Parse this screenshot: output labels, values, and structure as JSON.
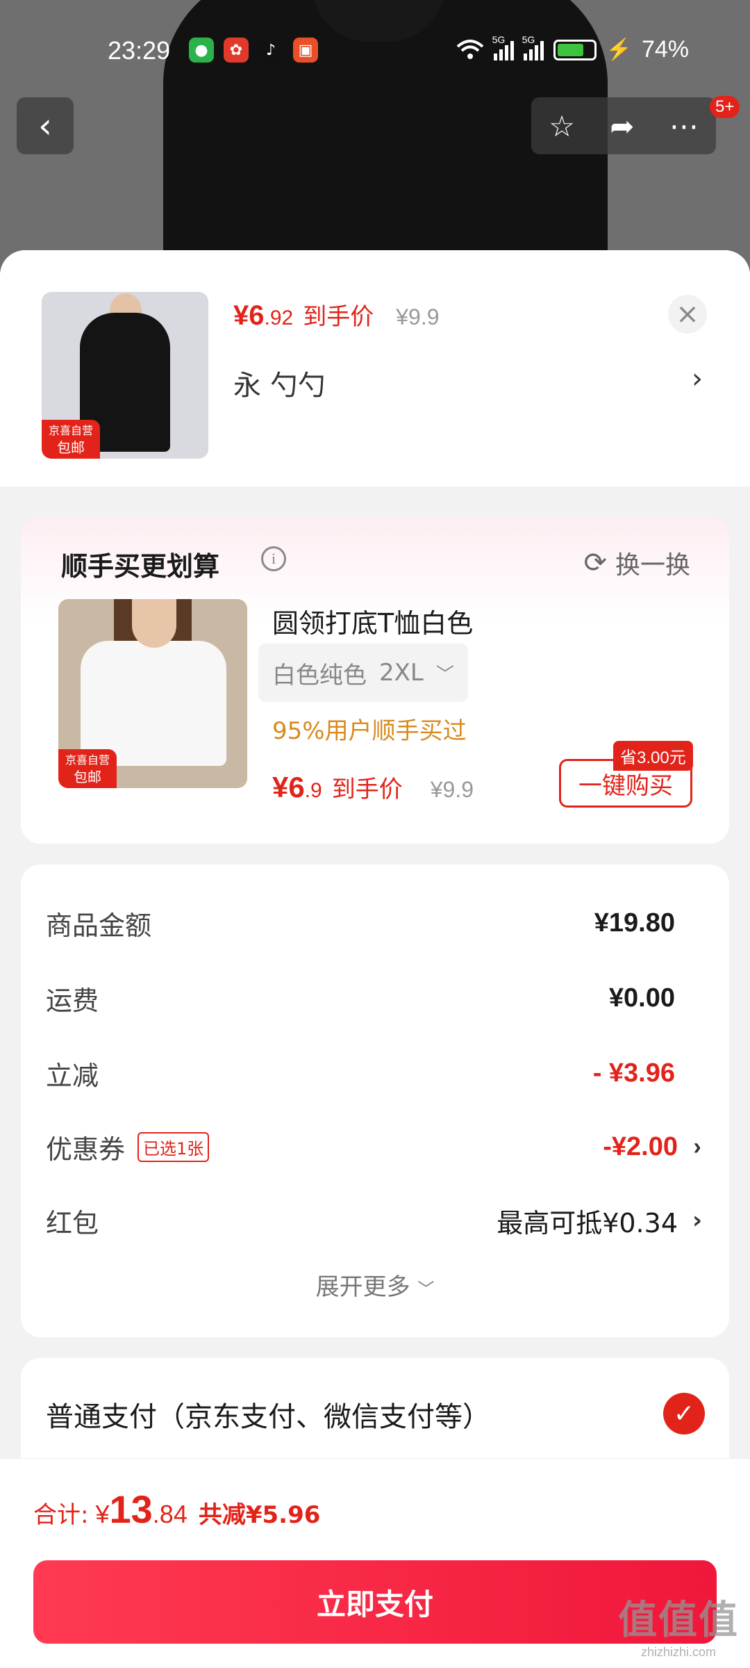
{
  "status_bar": {
    "time": "23:29",
    "battery": "74%",
    "net1": "5G",
    "net2": "5G"
  },
  "nav": {
    "badge": "5+"
  },
  "product": {
    "price_symbol": "¥",
    "price_int": "6",
    "price_dec": ".92",
    "price_tag": "到手价",
    "original_price": "¥9.9",
    "spec": "永 勺勺",
    "badge_top": "京喜自营",
    "badge_bottom": "包邮"
  },
  "upsell": {
    "title": "顺手买更划算",
    "refresh_label": "换一换",
    "item_name": "圆领打底T恤白色",
    "item_color": "白色纯色",
    "item_size": "2XL",
    "hint": "95%用户顺手买过",
    "price_symbol": "¥",
    "price_int": "6",
    "price_dec": ".9",
    "price_tag": "到手价",
    "original_price": "¥9.9",
    "buy_label": "一键购买",
    "save_badge": "省3.00元",
    "badge_top": "京喜自营",
    "badge_bottom": "包邮"
  },
  "summary": {
    "rows": [
      {
        "label": "商品金额",
        "value": "¥19.80"
      },
      {
        "label": "运费",
        "value": "¥0.00"
      },
      {
        "label": "立减",
        "value": "- ¥3.96"
      },
      {
        "label": "优惠券",
        "tag": "已选1张",
        "value": "-¥2.00"
      },
      {
        "label": "红包",
        "value": "最高可抵¥0.34"
      }
    ],
    "expand_label": "展开更多"
  },
  "payment": {
    "method_label": "普通支付（京东支付、微信支付等）"
  },
  "bottom": {
    "total_label": "合计:",
    "total_symbol": "¥",
    "total_int": "13",
    "total_dec": ".84",
    "saved_label": "共减¥5.96",
    "pay_label": "立即支付"
  },
  "watermark": {
    "text": "值值值",
    "url": "zhizhizhi.com"
  },
  "colors": {
    "accent": "#e2231a",
    "hint": "#d88a1c",
    "pay_button": "#f0173a"
  }
}
